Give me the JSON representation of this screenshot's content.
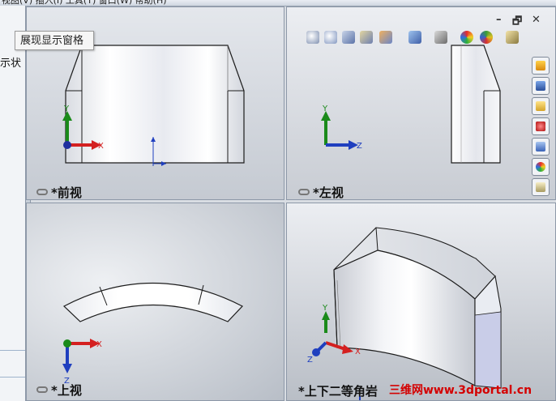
{
  "menu": {
    "text": "视图(V)  插入(I)  工具(T)  窗口(W)  帮助(H)"
  },
  "left_panel": {
    "partial_text": "示状"
  },
  "tooltip": {
    "text": "展现显示窗格"
  },
  "viewports": {
    "front": {
      "label": "*前视"
    },
    "left": {
      "label": "*左视"
    },
    "top": {
      "label": "*上视"
    },
    "iso": {
      "label": "*上下二等角岩"
    }
  },
  "axes": {
    "x": "X",
    "y": "Y",
    "z": "Z"
  },
  "window_controls": {
    "minimize": "–",
    "restore": "🗗",
    "close": "✕"
  },
  "view_toolbar": {
    "icons": [
      "zoom-to-fit-icon",
      "zoom-to-area-icon",
      "previous-view-icon",
      "section-view-icon",
      "view-orientation-icon",
      "display-style-icon",
      "hide-show-icon",
      "edit-appearance-icon",
      "apply-scene-icon",
      "view-settings-icon"
    ]
  },
  "task_pane": {
    "icons": [
      "home-icon",
      "resources-icon",
      "design-library-icon",
      "file-explorer-icon",
      "view-palette-icon",
      "appearances-icon",
      "custom-properties-icon"
    ]
  },
  "watermark": {
    "text": "三维网www.3dportal.cn"
  },
  "colors": {
    "x_axis": "#d42020",
    "y_axis": "#1a8a1a",
    "z_axis": "#1f3fbf",
    "part_edge": "#1c1c1c",
    "watermark": "#d40000"
  }
}
